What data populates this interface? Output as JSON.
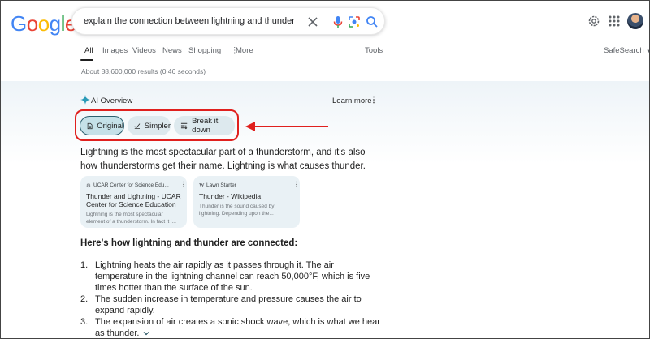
{
  "search": {
    "query": "explain the connection between lightning and thunder"
  },
  "logo_letters": [
    "G",
    "o",
    "o",
    "g",
    "l",
    "e"
  ],
  "logo_colors": [
    "#4285F4",
    "#EA4335",
    "#FBBC05",
    "#4285F4",
    "#34A853",
    "#EA4335"
  ],
  "tabs": [
    "All",
    "Images",
    "Videos",
    "News",
    "Shopping",
    "More"
  ],
  "tools_label": "Tools",
  "safesearch_label": "SafeSearch",
  "results_count": "About 88,600,000 results (0.46 seconds)",
  "ai_overview": {
    "title": "AI Overview",
    "learn_more": "Learn more",
    "chips": [
      "Original",
      "Simpler",
      "Break it down"
    ],
    "paragraph": "Lightning is the most spectacular part of a thunderstorm, and it's also how thunderstorms get their name. Lightning is what causes thunder.",
    "sources": [
      {
        "site": "UCAR Center for Science Edu...",
        "title": "Thunder and Lightning - UCAR Center for Science Education",
        "snippet": "Lightning is the most spectacular element of a thunderstorm. In fact it i..."
      },
      {
        "site": "Lawn Starter",
        "title": "Thunder - Wikipedia",
        "snippet": "Thunder is the sound caused by lightning. Depending upon the..."
      }
    ],
    "subheading": "Here's how lightning and thunder are connected:",
    "steps": [
      "Lightning heats the air rapidly as it passes through it. The air temperature in the lightning channel can reach 50,000°F, which is five times hotter than the surface of the sun.",
      "The sudden increase in temperature and pressure causes the air to expand rapidly.",
      "The expansion of air creates a sonic shock wave, which is what we hear as thunder."
    ]
  },
  "colors": {
    "highlight_outline": "#e0201e",
    "chip_bg": "#dde9ee",
    "card_bg": "#e9f1f5"
  }
}
